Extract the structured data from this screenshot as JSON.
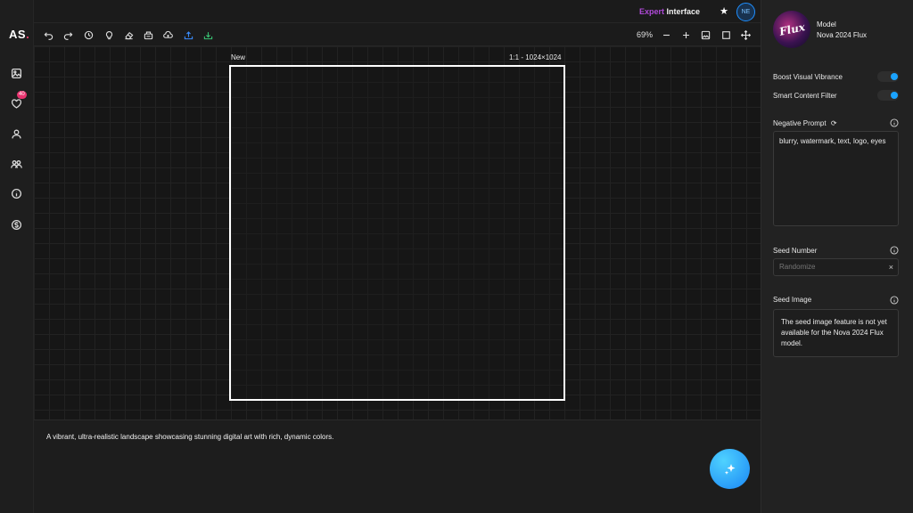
{
  "app": {
    "logo_text": "AS",
    "logo_dot": "."
  },
  "sidebar": {
    "items": [
      {
        "name": "image-icon"
      },
      {
        "name": "heart-icon",
        "badge": "40"
      },
      {
        "name": "user-icon"
      },
      {
        "name": "users-icon"
      },
      {
        "name": "info-icon"
      },
      {
        "name": "dollar-icon"
      }
    ]
  },
  "header": {
    "mode_prefix": "Expert",
    "mode_suffix": "Interface",
    "star": "★",
    "avatar_initials": "NE"
  },
  "toolbar": {
    "icons": [
      "undo-icon",
      "redo-icon",
      "history-icon",
      "lightbulb-icon",
      "eraser-icon",
      "basket-icon",
      "cloud-upload-icon",
      "upload-icon",
      "download-icon"
    ],
    "zoom": "69%",
    "right_icons": [
      "zoom-out-icon",
      "zoom-in-icon",
      "image-frame-icon",
      "square-icon",
      "move-icon"
    ]
  },
  "canvas": {
    "frame_name": "New",
    "frame_size": "1:1 - 1024×1024"
  },
  "prompt": {
    "text": "A vibrant, ultra-realistic landscape showcasing stunning digital art with rich, dynamic colors."
  },
  "panel": {
    "model_label": "Model",
    "model_name": "Nova 2024 Flux",
    "model_thumb_text": "Flux",
    "boost_label": "Boost Visual Vibrance",
    "boost_on": true,
    "filter_label": "Smart Content Filter",
    "filter_on": true,
    "negative_label": "Negative Prompt",
    "negative_value": "blurry, watermark, text, logo, eyes",
    "seed_label": "Seed Number",
    "seed_placeholder": "Randomize",
    "seed_clear": "×",
    "seed_image_label": "Seed Image",
    "seed_image_note": "The seed image feature is not yet available for the Nova 2024 Flux model."
  },
  "colors": {
    "accent": "#1aa3ff",
    "expert": "#b04ad9",
    "logo_dot": "#ff3d6e",
    "badge": "#e8336f"
  }
}
